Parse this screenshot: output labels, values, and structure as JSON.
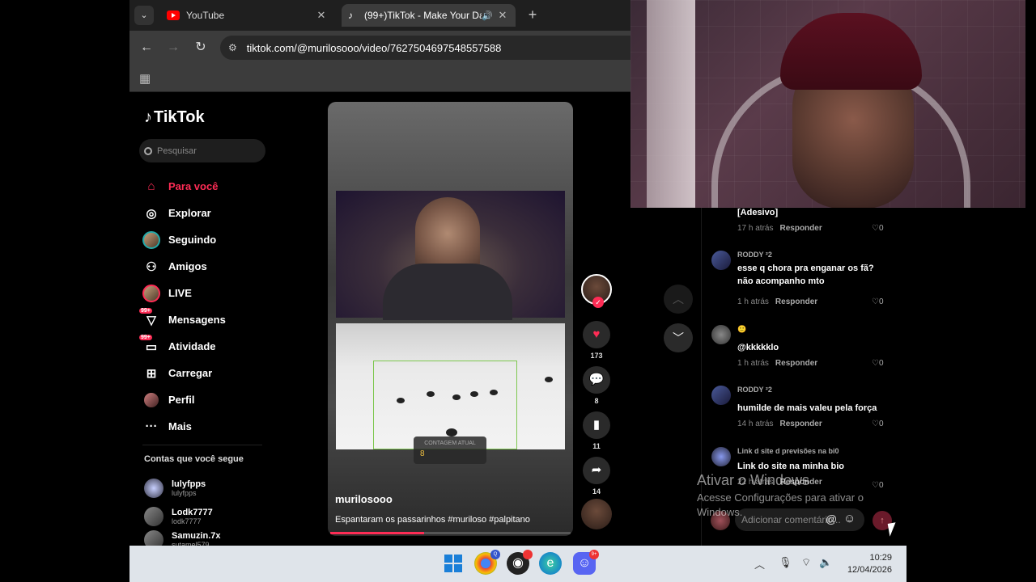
{
  "browser": {
    "tabs": [
      {
        "title": "YouTube",
        "favicon": "youtube-icon"
      },
      {
        "title": "(99+)TikTok - Make Your Da",
        "favicon": "tiktok-icon",
        "active": true
      }
    ],
    "url": "tiktok.com/@murilosooo/video/7627504697548557588"
  },
  "tiktok": {
    "logo": "TikTok",
    "search_placeholder": "Pesquisar",
    "nav": [
      {
        "label": "Para você",
        "icon": "home-icon",
        "active": true
      },
      {
        "label": "Explorar",
        "icon": "compass-icon"
      },
      {
        "label": "Seguindo",
        "icon": "following-avatar-icon"
      },
      {
        "label": "Amigos",
        "icon": "friends-icon"
      },
      {
        "label": "LIVE",
        "icon": "live-icon"
      },
      {
        "label": "Mensagens",
        "icon": "messages-icon",
        "badge": "99+"
      },
      {
        "label": "Atividade",
        "icon": "activity-icon",
        "badge": "99+"
      },
      {
        "label": "Carregar",
        "icon": "upload-icon"
      },
      {
        "label": "Perfil",
        "icon": "profile-icon"
      },
      {
        "label": "Mais",
        "icon": "more-icon"
      }
    ],
    "following_title": "Contas que você segue",
    "following": [
      {
        "name": "lulyfpps",
        "handle": "lulyfpps"
      },
      {
        "name": "Lodk7777",
        "handle": "lodk7777"
      },
      {
        "name": "Samuzin.7x",
        "handle": "sutamel579"
      }
    ],
    "video": {
      "author": "murilosooo",
      "description": "Espantaram os passarinhos #muriloso #palpitano",
      "counter_label": "CONTAGEM ATUAL",
      "counter_value": "8",
      "progress": 0.39
    },
    "actions": {
      "likes": "173",
      "comments": "8",
      "saves": "11",
      "shares": "14"
    }
  },
  "comments": [
    {
      "user": "",
      "text": "[Adesivo]",
      "time": "17 h atrás",
      "reply": "Responder",
      "likes": "0"
    },
    {
      "user": "RODDY ²2",
      "text": "esse q chora pra enganar os fã? não acompanho mto",
      "time": "1 h atrás",
      "reply": "Responder",
      "likes": "0"
    },
    {
      "user": "🙂",
      "text": "@kkkkklo",
      "time": "1 h atrás",
      "reply": "Responder",
      "likes": "0"
    },
    {
      "user": "RODDY ²2",
      "text": "humilde de mais valeu pela força",
      "time": "14 h atrás",
      "reply": "Responder",
      "likes": "0"
    },
    {
      "user": "Link d site d previsões na bi0",
      "text": "Link do site na minha bio",
      "time": "22 h atrás",
      "reply": "Responder",
      "likes": "0"
    }
  ],
  "add_comment_placeholder": "Adicionar comentário...",
  "watermark": {
    "title": "Ativar o Windows",
    "subtitle": "Acesse Configurações para ativar o Windows."
  },
  "taskbar": {
    "time": "10:29",
    "date": "12/04/2026"
  }
}
